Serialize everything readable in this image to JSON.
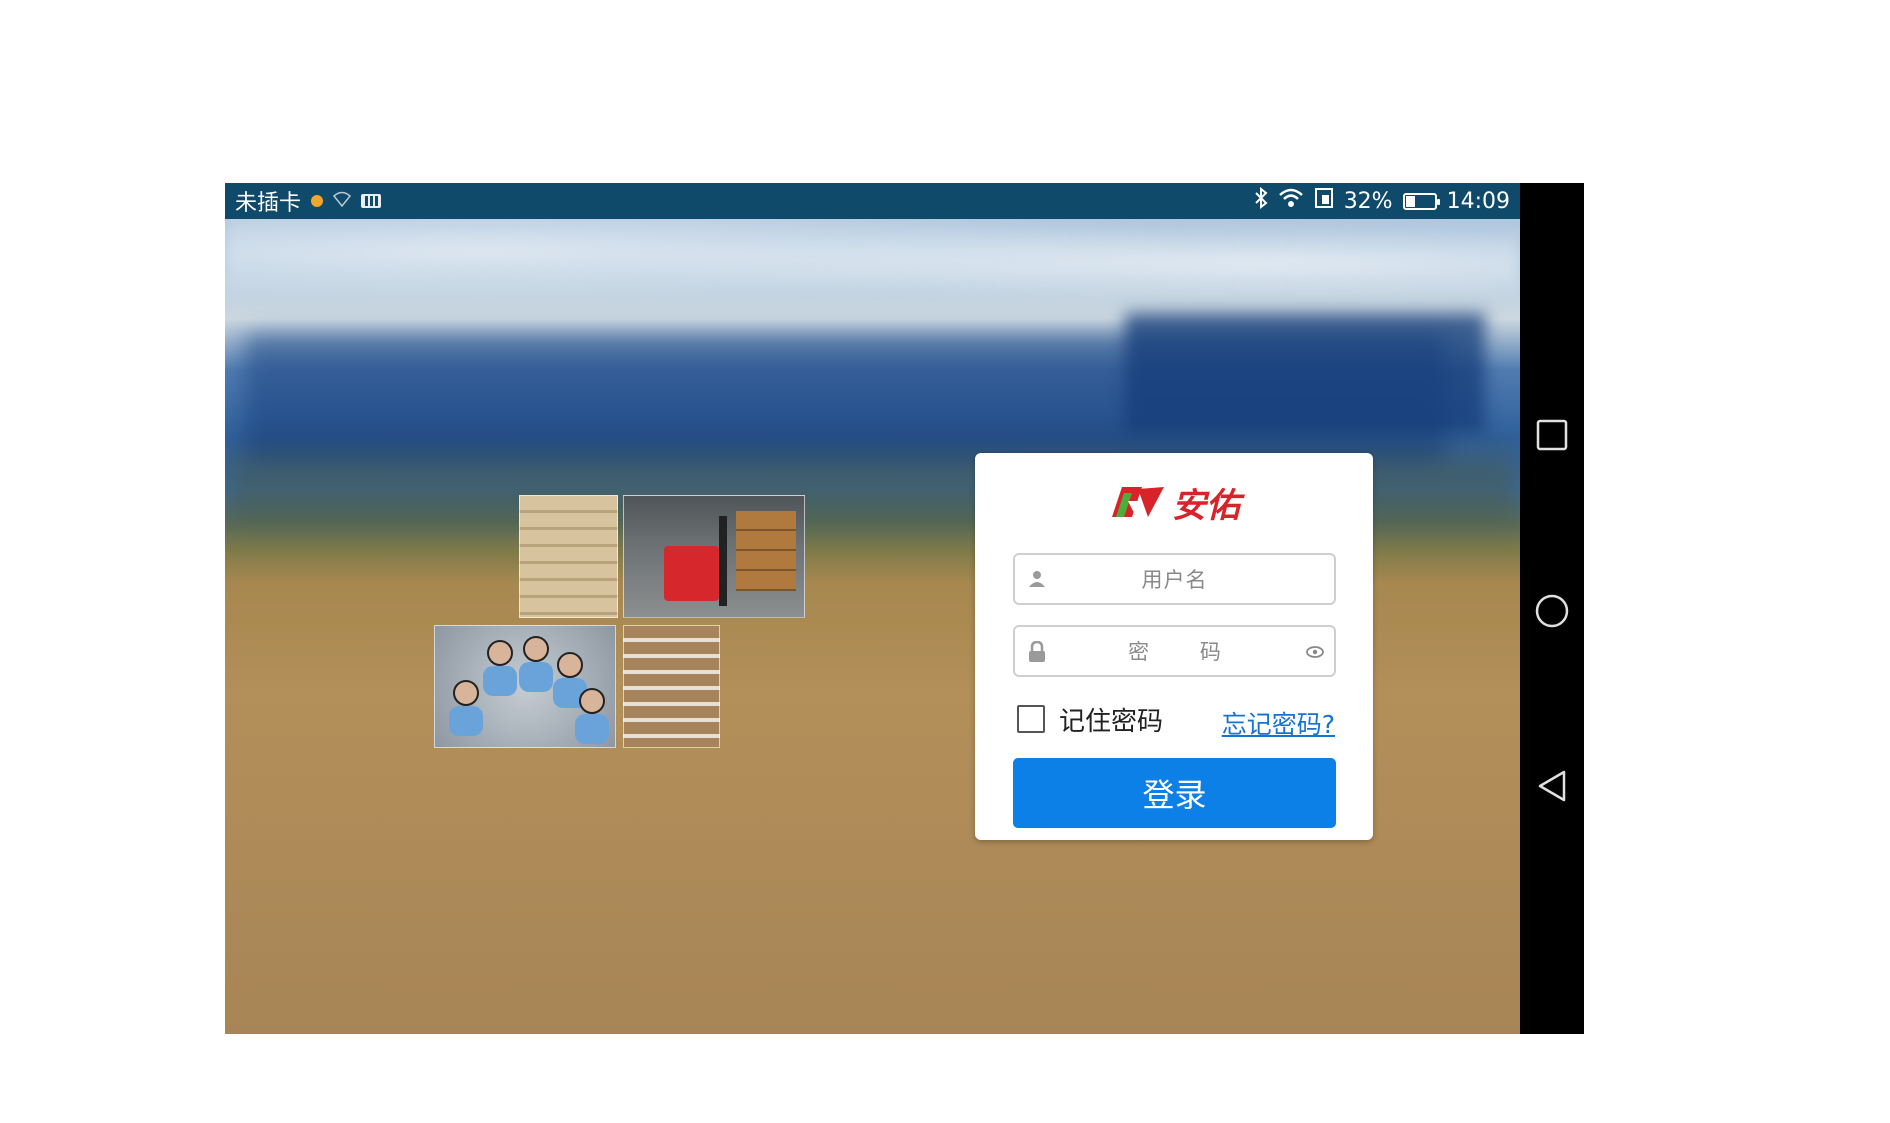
{
  "status_bar": {
    "carrier": "未插卡",
    "battery_percent": "32%",
    "battery_level": 0.32,
    "time": "14:09",
    "icons": [
      "notification-dot-icon",
      "wifi-weak-icon",
      "keyboard-icon",
      "bluetooth-icon",
      "wifi-icon",
      "sim-icon",
      "battery-icon"
    ]
  },
  "brand": {
    "logo_text": "安佑",
    "color": "#d8232a"
  },
  "login": {
    "username_placeholder": "用户名",
    "password_placeholder": "密 码",
    "remember_label": "记住密码",
    "remember_checked": false,
    "forgot_label": "忘记密码?",
    "submit_label": "登录",
    "accent_color": "#0d80e8"
  },
  "nav_bar": {
    "buttons": [
      "recent-apps",
      "home",
      "back"
    ]
  }
}
